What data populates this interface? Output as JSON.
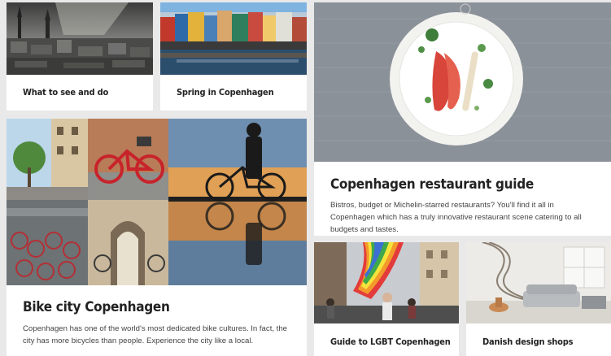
{
  "cards": {
    "what_to_see": {
      "title": "What to see and do"
    },
    "spring": {
      "title": "Spring in Copenhagen"
    },
    "restaurant": {
      "title": "Copenhagen restaurant guide",
      "description": "Bistros, budget or Michelin-starred restaurants? You'll find it all in Copenhagen which has a truly innovative restaurant scene catering to all budgets and tastes."
    },
    "bike": {
      "title": "Bike city Copenhagen",
      "description": "Copenhagen has one of the world's most dedicated bike cultures. In fact, the city has more bicycles than people. Experience the city like a local."
    },
    "lgbt": {
      "title": "Guide to LGBT Copenhagen"
    },
    "design": {
      "title": "Danish design shops"
    }
  },
  "colors": {
    "page_bg": "#e9e9e9",
    "card_bg": "#ffffff",
    "title": "#222222",
    "text": "#444444"
  }
}
